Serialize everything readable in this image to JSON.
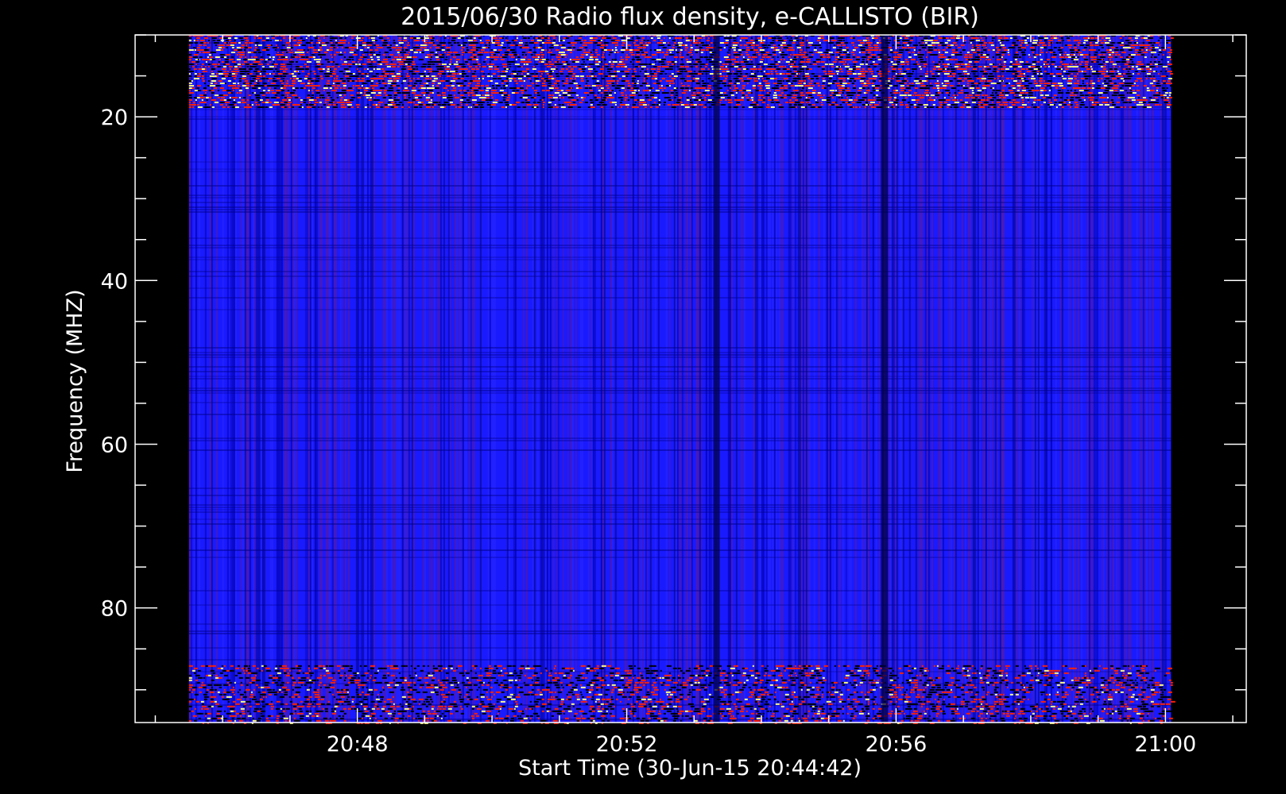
{
  "chart_data": {
    "type": "heatmap",
    "title": "2015/06/30  Radio flux density, e-CALLISTO (BIR)",
    "xlabel": "Start Time (30-Jun-15 20:44:42)",
    "ylabel": "Frequency (MHZ)",
    "x_tick_labels": [
      "20:48",
      "20:52",
      "20:56",
      "21:00"
    ],
    "y_tick_labels": [
      "20",
      "40",
      "60",
      "80"
    ],
    "xlim": [
      "20:44:42",
      "21:01:12"
    ],
    "ylim": [
      94,
      10
    ],
    "y_axis_direction": "inverted",
    "frequency_coverage_mhz": [
      10,
      94
    ],
    "time_coverage": [
      "20:45:30",
      "21:00:05"
    ],
    "colormap": [
      "#000000",
      "#0000ff",
      "#ff2000",
      "#ffff80"
    ],
    "features": [
      {
        "kind": "rfi-band",
        "freq_mhz": [
          10,
          19
        ],
        "intensity": "high"
      },
      {
        "kind": "rfi-band",
        "freq_mhz": [
          87,
          94
        ],
        "intensity": "medium"
      },
      {
        "kind": "drop-out",
        "time": "20:53:20",
        "freq_mhz": [
          10,
          94
        ]
      },
      {
        "kind": "drop-out",
        "time": "20:55:50",
        "freq_mhz": [
          10,
          94
        ]
      }
    ]
  },
  "colors": {
    "background": "#000000",
    "axis": "#ffffff",
    "dominant": "#1a1aff"
  }
}
